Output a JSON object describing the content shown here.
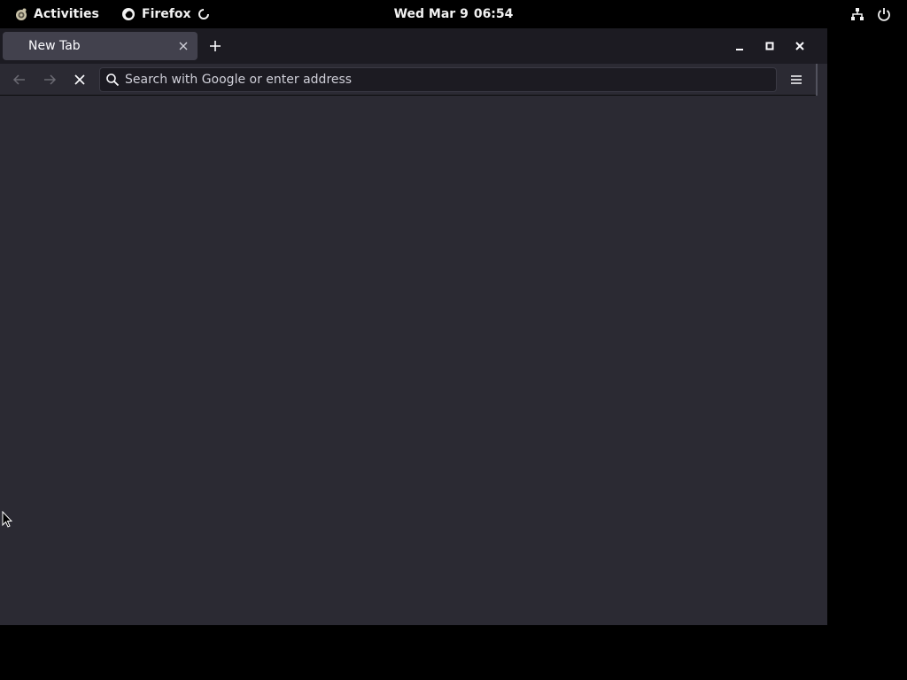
{
  "topbar": {
    "activities_label": "Activities",
    "app_name": "Firefox",
    "clock_date": "Wed Mar 9",
    "clock_time": "06:54",
    "icons": [
      "gnome-icon",
      "firefox-icon",
      "loading-spinner-icon",
      "network-icon",
      "power-icon"
    ]
  },
  "window": {
    "tabs": [
      {
        "title": "New Tab",
        "active": true
      }
    ],
    "urlbar": {
      "placeholder": "Search with Google or enter address",
      "value": ""
    },
    "nav_icons": [
      "back-arrow-icon",
      "forward-arrow-icon",
      "stop-icon",
      "hamburger-menu-icon"
    ],
    "colors": {
      "tabbar_bg": "#1c1b22",
      "tab_active_bg": "#42414d",
      "toolbar_bg": "#2b2a33",
      "content_bg": "#2b2a33",
      "urlbar_bg": "#1c1b22"
    }
  }
}
